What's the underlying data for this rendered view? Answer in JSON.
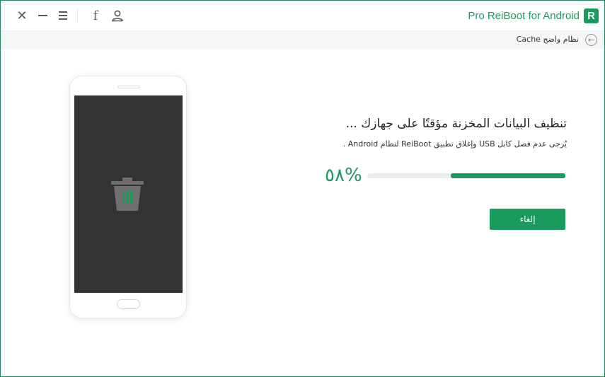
{
  "titlebar": {
    "app_title": "Pro ReiBoot for Android",
    "logo_letter": "R",
    "close_glyph": "✕",
    "facebook_glyph": "f",
    "icons": [
      "close-icon",
      "minimize-icon",
      "menu-icon",
      "facebook-icon",
      "user-icon"
    ]
  },
  "breadcrumb": {
    "text": "نظام واضح Cache",
    "back_glyph": "←"
  },
  "progress": {
    "heading": "تنظيف البيانات المخزنة مؤقتًا على جهازك ...",
    "subtext": "يُرجى عدم فصل كابل USB وإغلاق تطبيق ReiBoot لنظام Android .",
    "percent_label": "%٥٨",
    "value": 0.58
  },
  "cancel_button": {
    "label": "إلغاء"
  },
  "colors": {
    "accent": "#1b9a5e",
    "phone_screen": "#333333",
    "trash_gray": "#6f6f6f",
    "track": "#eaeded"
  }
}
